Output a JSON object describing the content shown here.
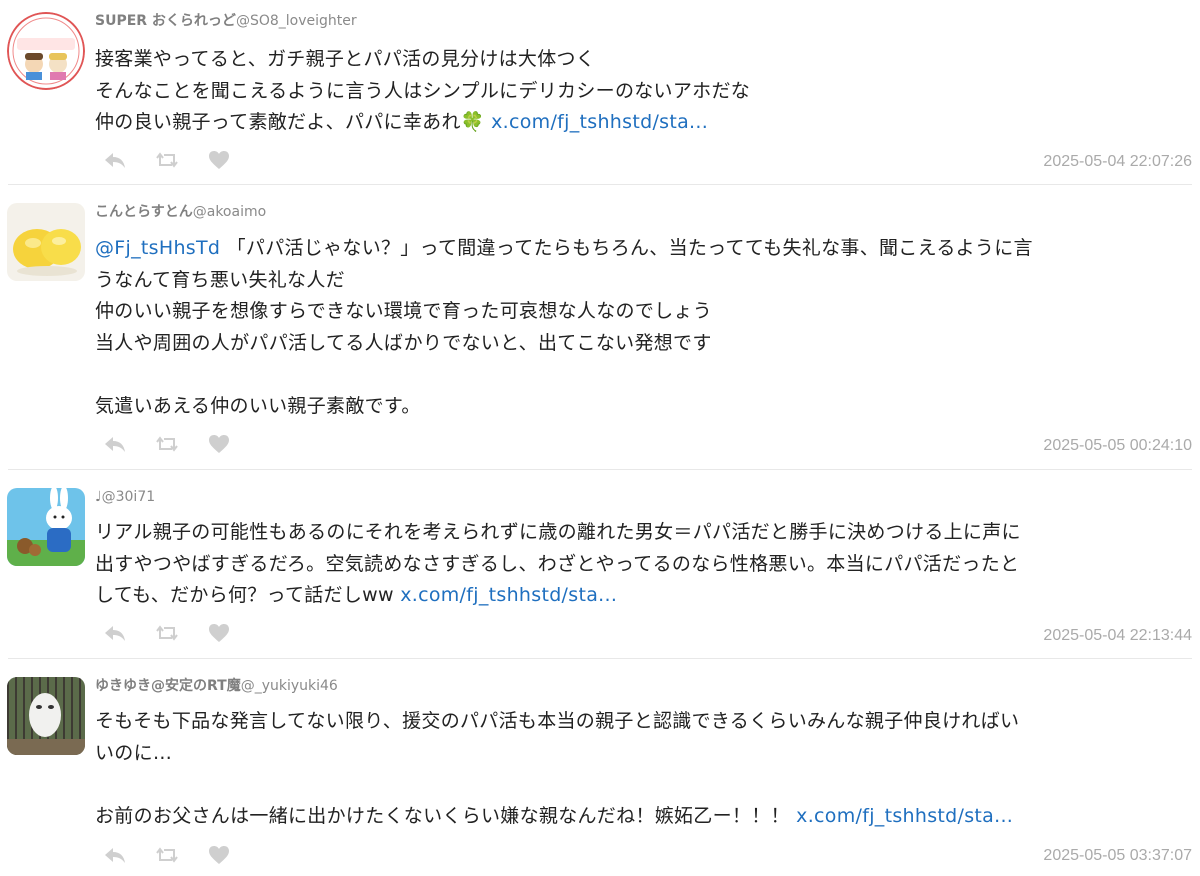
{
  "tweets": [
    {
      "name": "SUPER おくられっど",
      "handle": "@SO8_loveighter",
      "avatar_icon": "super-okuraredo-avatar",
      "avatar_text": "SUPER おくられっど",
      "lines": [
        "接客業やってると、ガチ親子とパパ活の見分けは大体つく",
        "そんなことを聞こえるように言う人はシンプルにデリカシーのないアホだな",
        "仲の良い親子って素敵だよ、パパに幸あれ"
      ],
      "emoji": "🍀",
      "link": "x.com/fj_tshhstd/sta...",
      "timestamp": "2025-05-04 22:07:26"
    },
    {
      "name": "こんとらすとん",
      "handle": "@akoaimo",
      "avatar_icon": "lemon-avatar",
      "mention": "@Fj_tsHhsTd",
      "line1_rest": " 「パパ活じゃない？」って間違ってたらもちろん、当たってても失礼な事、聞こえるように言",
      "lines": [
        "うなんて育ち悪い失礼な人だ",
        "仲のいい親子を想像すらできない環境で育った可哀想な人なのでしょう",
        "当人や周囲の人がパパ活してる人ばかりでないと、出てこない発想です",
        "",
        "気遣いあえる仲のいい親子素敵です。"
      ],
      "timestamp": "2025-05-05 00:24:10"
    },
    {
      "name": "♩",
      "handle": "@30i71",
      "avatar_icon": "rabbit-avatar",
      "lines": [
        "リアル親子の可能性もあるのにそれを考えられずに歳の離れた男女＝パパ活だと勝手に決めつける上に声に",
        "出すやつやばすぎるだろ。空気読めなさすぎるし、わざとやってるのなら性格悪い。本当にパパ活だったと",
        "しても、だから何？って話だしww"
      ],
      "link": "x.com/fj_tshhstd/sta...",
      "timestamp": "2025-05-04 22:13:44"
    },
    {
      "name": "ゆきゆき@安定のRT魔",
      "handle": "@_yukiyuki46",
      "avatar_icon": "owl-avatar",
      "lines": [
        "そもそも下品な発言してない限り、援交のパパ活も本当の親子と認識できるくらいみんな親子仲良ければい",
        "いのに…",
        "",
        "お前のお父さんは一緒に出かけたくないくらい嫌な親なんだね！嫉妬乙ー！！！"
      ],
      "link": "x.com/fj_tshhstd/sta...",
      "timestamp": "2025-05-05 03:37:07"
    }
  ],
  "actions": {
    "reply_icon": "reply-icon",
    "retweet_icon": "retweet-icon",
    "like_icon": "heart-icon"
  },
  "colors": {
    "link": "#1f6fbf",
    "muted": "#aaaaaa",
    "icon": "#cfcfcf"
  }
}
